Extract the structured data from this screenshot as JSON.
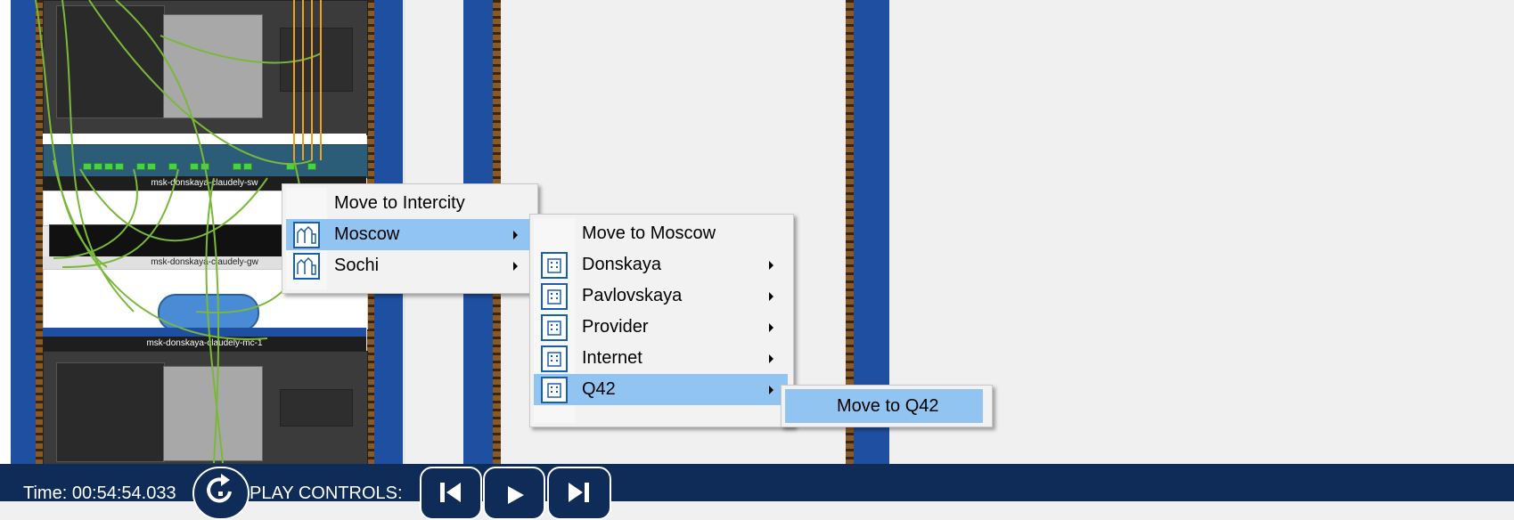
{
  "rack": {
    "devices": [
      {
        "label": "msk-donskaya-claudely-sw"
      },
      {
        "label": "msk-donskaya-claudely-gw"
      },
      {
        "label": "msk-donskaya-claudely-mc-1"
      }
    ]
  },
  "menu_level1": {
    "items": [
      {
        "label": "Move to Intercity",
        "icon": "",
        "has_submenu": false
      },
      {
        "label": "Moscow",
        "icon": "city-icon",
        "has_submenu": true,
        "active": true
      },
      {
        "label": "Sochi",
        "icon": "city-icon",
        "has_submenu": true
      }
    ]
  },
  "menu_level2": {
    "items": [
      {
        "label": "Move to Moscow",
        "icon": "",
        "has_submenu": false
      },
      {
        "label": "Donskaya",
        "icon": "building-icon",
        "has_submenu": true
      },
      {
        "label": "Pavlovskaya",
        "icon": "building-icon",
        "has_submenu": true
      },
      {
        "label": "Provider",
        "icon": "building-icon",
        "has_submenu": true
      },
      {
        "label": "Internet",
        "icon": "building-icon",
        "has_submenu": true
      },
      {
        "label": "Q42",
        "icon": "building-icon",
        "has_submenu": true,
        "active": true
      }
    ]
  },
  "menu_level3": {
    "items": [
      {
        "label": "Move to Q42",
        "active": true
      }
    ]
  },
  "bottom_bar": {
    "time_label": "Time: 00:54:54.033",
    "play_controls_label": "PLAY CONTROLS:"
  },
  "colors": {
    "menu_highlight": "#92c4f2",
    "bottom_bar": "#0f2b57",
    "rack_pillar": "#1f4fa0",
    "cable_green": "#7ab83a",
    "cable_orange": "#f0a020"
  }
}
